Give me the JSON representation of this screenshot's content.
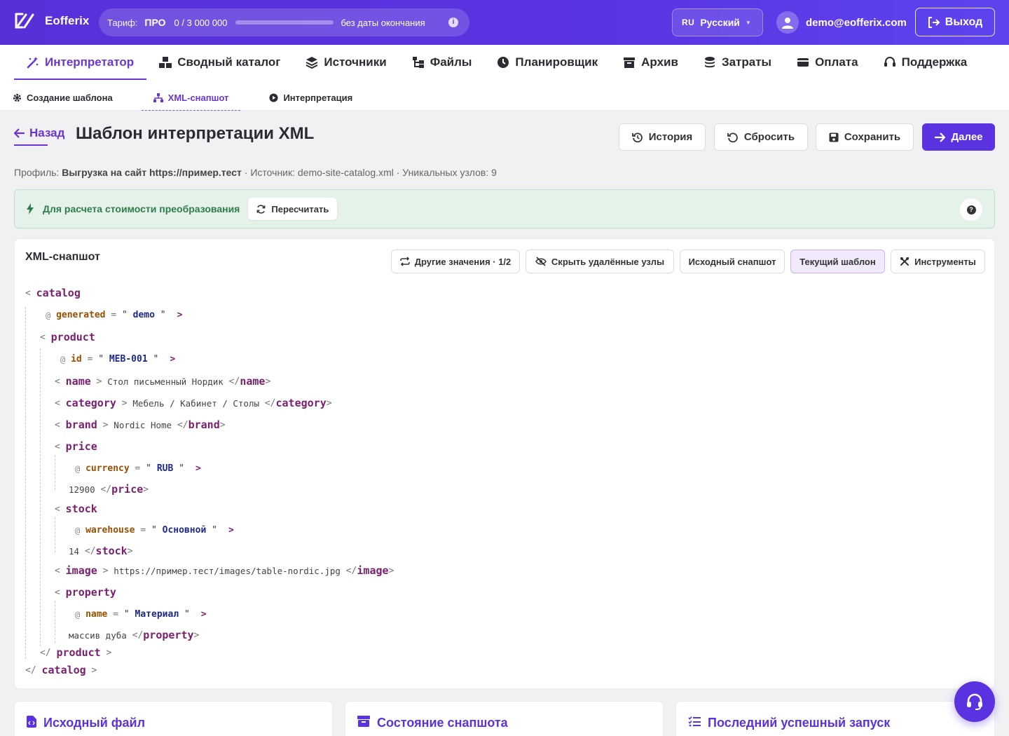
{
  "app": {
    "name": "Eofferix"
  },
  "tariff": {
    "label": "Тариф:",
    "plan": "ПРО",
    "used": "0",
    "separator": "/",
    "limit": "3 000 000",
    "progress": 0,
    "expiry": "без даты окончания"
  },
  "lang": {
    "code": "RU",
    "name": "Русский"
  },
  "user": {
    "email": "demo@eofferix.com"
  },
  "logout_label": "Выход",
  "main_nav": [
    {
      "label": "Интерпретатор",
      "icon": "magic-wand-icon",
      "active": true
    },
    {
      "label": "Сводный каталог",
      "icon": "cubes-icon"
    },
    {
      "label": "Источники",
      "icon": "layers-icon"
    },
    {
      "label": "Файлы",
      "icon": "folder-tree-icon"
    },
    {
      "label": "Планировщик",
      "icon": "clock-icon"
    },
    {
      "label": "Архив",
      "icon": "archive-icon"
    },
    {
      "label": "Затраты",
      "icon": "coins-icon"
    },
    {
      "label": "Оплата",
      "icon": "credit-card-icon"
    },
    {
      "label": "Поддержка",
      "icon": "headset-icon"
    }
  ],
  "sub_nav": [
    {
      "label": "Создание шаблона",
      "icon": "gear-icon"
    },
    {
      "label": "XML-снапшот",
      "icon": "sitemap-icon",
      "active": true
    },
    {
      "label": "Интерпретация",
      "icon": "play-circle-icon"
    }
  ],
  "page": {
    "back_label": "Назад",
    "title": "Шаблон интерпретации XML",
    "actions": {
      "history": "История",
      "reset": "Сбросить",
      "save": "Сохранить",
      "next": "Далее"
    },
    "meta": {
      "profile_label": "Профиль:",
      "profile": "Выгрузка на сайт https://пример.тест",
      "source": " · Источник: demo-site-catalog.xml",
      "nodes": " · Уникальных узлов: 9"
    }
  },
  "alert": {
    "text": "Для расчета стоимости преобразования",
    "button": "Пересчитать",
    "help": "?"
  },
  "snapshot": {
    "title": "XML-снапшот",
    "toolbar": {
      "other_values": "Другие значения · 1/2",
      "hide_deleted": "Скрыть удалённые узлы",
      "source_snapshot": "Исходный снапшот",
      "current_template": "Текущий шаблон",
      "tools": "Инструменты"
    },
    "xml": {
      "lt": "<",
      "gt": ">",
      "close_open": "</",
      "at": "@",
      "eq": "=",
      "q": "\"",
      "catalog": "catalog",
      "attr_generated": "generated",
      "val_generated": "demo",
      "product": "product",
      "attr_id": "id",
      "val_id": "MEB-001",
      "name": "name",
      "name_text": "Стол письменный Нордик",
      "category": "category",
      "category_text": "Мебель / Кабинет / Столы",
      "brand": "brand",
      "brand_text": "Nordic Home",
      "price": "price",
      "attr_currency": "currency",
      "val_currency": "RUB",
      "price_text": "12900",
      "stock": "stock",
      "attr_warehouse": "warehouse",
      "val_warehouse": "Основной",
      "stock_text": "14",
      "image": "image",
      "image_text": "https://пример.тест/images/table-nordic.jpg",
      "property": "property",
      "attr_name": "name",
      "val_name": "Материал",
      "property_text": "массив дуба"
    }
  },
  "bottom_cards": [
    {
      "title": "Исходный файл",
      "icon": "file-code-icon"
    },
    {
      "title": "Состояние снапшота",
      "icon": "box-archive-icon"
    },
    {
      "title": "Последний успешный запуск",
      "icon": "list-check-icon"
    }
  ],
  "colors": {
    "brand": "#5a32e0",
    "active": "#6a35d6",
    "tag": "#7a1f6e",
    "attr": "#9a4f00",
    "value": "#1d2a8a",
    "alert_bg": "#e4f2e9",
    "alert_text": "#2e7d4a"
  }
}
